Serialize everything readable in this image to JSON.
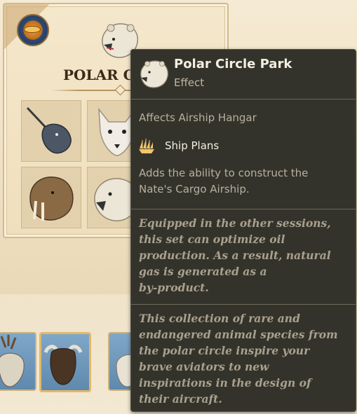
{
  "set_panel": {
    "title": "POLAR CIRCLE PARK",
    "items": [
      {
        "icon": "narwhal-icon"
      },
      {
        "icon": "arctic-fox-icon"
      },
      {
        "icon": "walrus-icon"
      },
      {
        "icon": "polar-bear-icon"
      }
    ]
  },
  "bottom_row": [
    {
      "icon": "reindeer-icon"
    },
    {
      "icon": "musk-ox-icon"
    },
    {
      "icon": "animal-icon"
    }
  ],
  "tooltip": {
    "icon": "polar-bear-icon",
    "title": "Polar Circle Park",
    "subtitle": "Effect",
    "affects": "Affects Airship Hangar",
    "unlock_icon": "ship-plans-icon",
    "unlock_label": "Ship Plans",
    "description_lines": [
      "Adds the ability to construct the",
      "Nate's Cargo Airship."
    ],
    "bonus_lines": [
      "Equipped in the other sessions,",
      "this set can optimize oil",
      "production. As a result, natural",
      "gas is generated as a",
      "by-product."
    ],
    "lore_lines": [
      "This collection of rare and",
      "endangered animal species from",
      "the polar circle inspire your",
      "brave aviators to new",
      "inspirations in the design of",
      "their aircraft."
    ]
  },
  "colors": {
    "tooltip_bg": "#34332b",
    "panel_bg": "#f4e7cb",
    "title_text": "#3a2a1a"
  }
}
